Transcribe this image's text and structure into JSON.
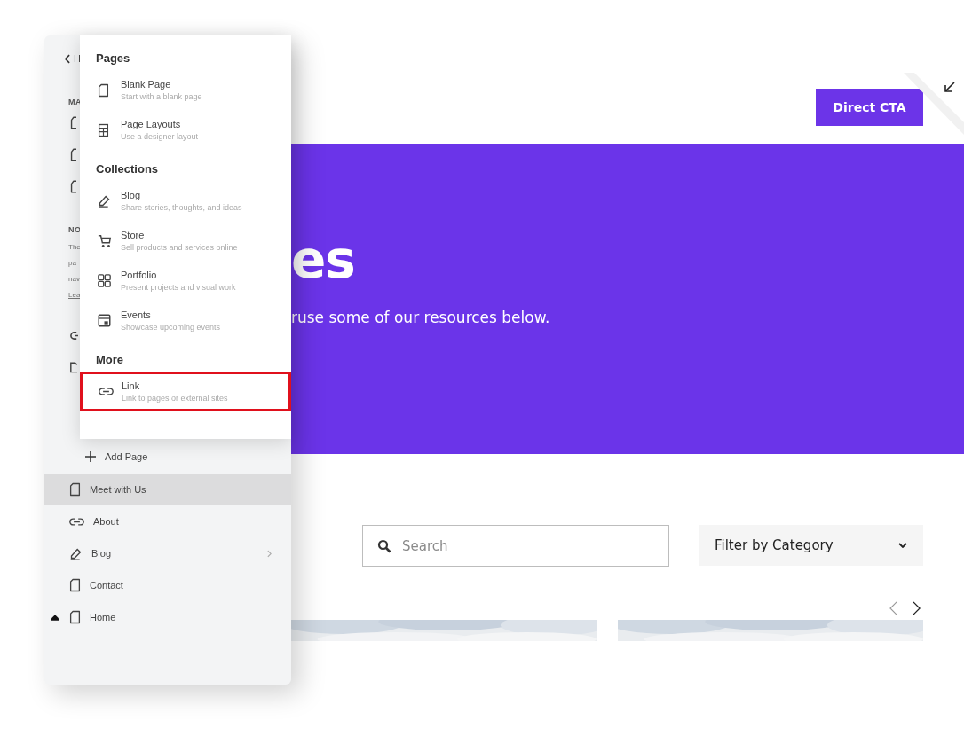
{
  "site": {
    "cta": "Direct CTA",
    "hero": {
      "title": "es",
      "subtitle": "ruse some of our resources below."
    },
    "search": {
      "placeholder": "Search"
    },
    "filter": {
      "value": "Filter by Category"
    }
  },
  "sidebar": {
    "back_text": "H",
    "main_heading": "MA",
    "main_items": [
      {
        "kind": "page"
      },
      {
        "kind": "page"
      },
      {
        "kind": "page"
      }
    ],
    "note_heading": "NO",
    "note_lines": [
      "The",
      "pa",
      "nav",
      "Lea"
    ],
    "extra_items": [
      {
        "kind": "link"
      },
      {
        "kind": "folder"
      }
    ],
    "add_page": "Add Page",
    "pages": [
      {
        "label": "Meet with Us",
        "kind": "page",
        "selected": true,
        "home": false,
        "has_children": false
      },
      {
        "label": "About",
        "kind": "link",
        "selected": false,
        "home": false,
        "has_children": false
      },
      {
        "label": "Blog",
        "kind": "blog",
        "selected": false,
        "home": false,
        "has_children": true
      },
      {
        "label": "Contact",
        "kind": "page",
        "selected": false,
        "home": false,
        "has_children": false
      },
      {
        "label": "Home",
        "kind": "page",
        "selected": false,
        "home": true,
        "has_children": false
      }
    ]
  },
  "add_menu": {
    "sections": [
      {
        "heading": "Pages",
        "items": [
          {
            "kind": "page",
            "title": "Blank Page",
            "subtitle": "Start with a blank page",
            "highlighted": false
          },
          {
            "kind": "layout",
            "title": "Page Layouts",
            "subtitle": "Use a designer layout",
            "highlighted": false
          }
        ]
      },
      {
        "heading": "Collections",
        "items": [
          {
            "kind": "blog",
            "title": "Blog",
            "subtitle": "Share stories, thoughts, and ideas",
            "highlighted": false
          },
          {
            "kind": "store",
            "title": "Store",
            "subtitle": "Sell products and services online",
            "highlighted": false
          },
          {
            "kind": "portfolio",
            "title": "Portfolio",
            "subtitle": "Present projects and visual work",
            "highlighted": false
          },
          {
            "kind": "events",
            "title": "Events",
            "subtitle": "Showcase upcoming events",
            "highlighted": false
          }
        ]
      },
      {
        "heading": "More",
        "items": [
          {
            "kind": "link",
            "title": "Link",
            "subtitle": "Link to pages or external sites",
            "highlighted": true
          }
        ]
      }
    ]
  }
}
